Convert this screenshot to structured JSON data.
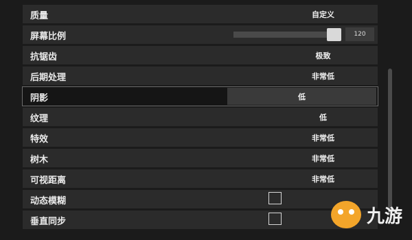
{
  "settings": {
    "rows": [
      {
        "label": "质量",
        "value": "自定义"
      },
      {
        "label": "屏幕比例",
        "slider_value": "120",
        "slider_fraction": 0.95
      },
      {
        "label": "抗锯齿",
        "value": "极致"
      },
      {
        "label": "后期处理",
        "value": "非常低"
      },
      {
        "label": "阴影",
        "value": "低"
      },
      {
        "label": "纹理",
        "value": "低"
      },
      {
        "label": "特效",
        "value": "非常低"
      },
      {
        "label": "树木",
        "value": "非常低"
      },
      {
        "label": "可视距离",
        "value": "非常低"
      },
      {
        "label": "动态模糊",
        "checked": false
      },
      {
        "label": "垂直同步",
        "checked": false
      }
    ]
  },
  "watermark": {
    "text": "九游",
    "logo_color": "#f3a52a"
  }
}
